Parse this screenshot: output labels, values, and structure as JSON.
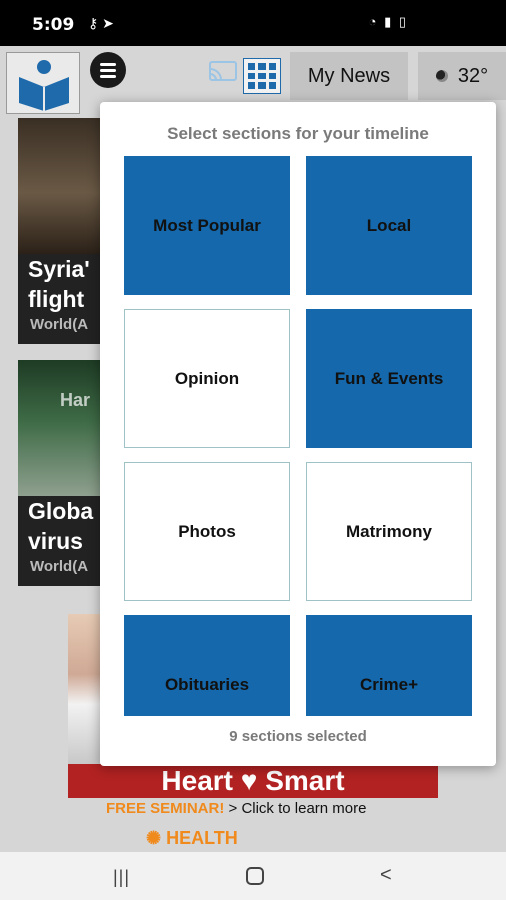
{
  "status_bar": {
    "time": "5:09",
    "left_icons": [
      "key-icon",
      "send-icon"
    ],
    "right_icons": [
      "wifi-icon",
      "signal-icon",
      "battery-icon"
    ]
  },
  "app_bar": {
    "my_news_label": "My News",
    "temperature": "32°"
  },
  "background_feed": [
    {
      "title_line1": "Syria'",
      "title_line2": "flight",
      "category": "World(A"
    },
    {
      "title_line1": "Globa",
      "title_line2": "virus",
      "category": "World(A",
      "overlay_text": "Har"
    }
  ],
  "ad": {
    "banner": "Heart ♥ Smart",
    "seminar_label": "FREE SEMINAR!",
    "seminar_link": " > Click to learn more",
    "brand": "HEALTH"
  },
  "modal": {
    "title": "Select sections for your timeline",
    "sections": [
      {
        "label": "Most Popular",
        "selected": true
      },
      {
        "label": "Local",
        "selected": true
      },
      {
        "label": "Opinion",
        "selected": false
      },
      {
        "label": "Fun & Events",
        "selected": true
      },
      {
        "label": "Photos",
        "selected": false
      },
      {
        "label": "Matrimony",
        "selected": false
      },
      {
        "label": "Obituaries",
        "selected": true
      },
      {
        "label": "Crime+",
        "selected": true
      }
    ],
    "footer": "9 sections selected"
  },
  "colors": {
    "selected_tile": "#1468ab",
    "unselected_border": "#9fc2c6",
    "accent_orange": "#f08a1c"
  }
}
